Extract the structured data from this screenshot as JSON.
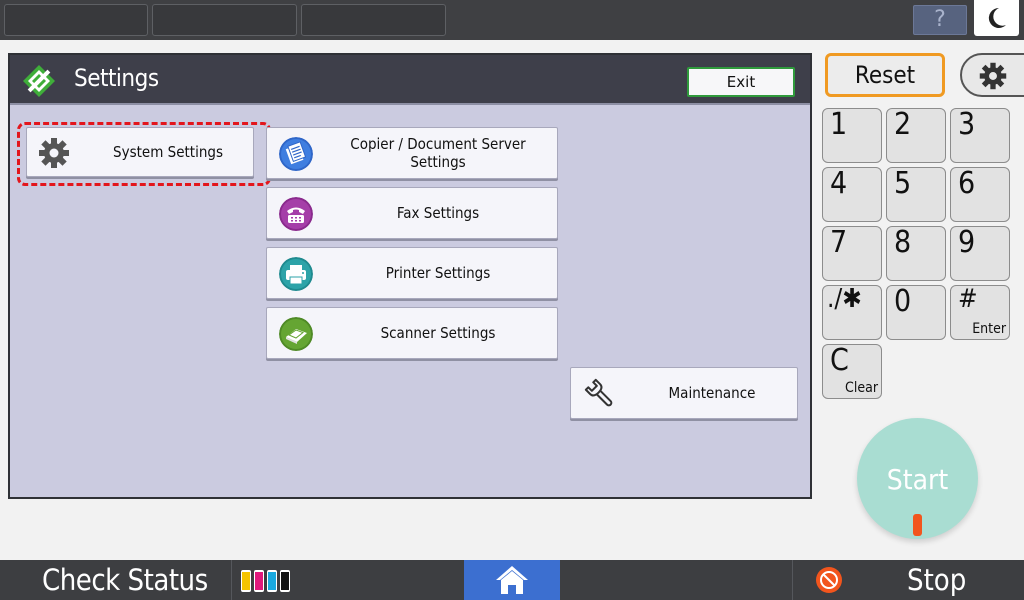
{
  "header": {
    "help_label": "?"
  },
  "panel": {
    "title": "Settings",
    "exit_label": "Exit"
  },
  "menu": {
    "system_settings": "System Settings",
    "copier_settings": "Copier / Document Server Settings",
    "fax_settings": "Fax Settings",
    "printer_settings": "Printer Settings",
    "scanner_settings": "Scanner Settings",
    "maintenance": "Maintenance"
  },
  "keypad": {
    "reset_label": "Reset",
    "keys": [
      {
        "label": "1"
      },
      {
        "label": "2"
      },
      {
        "label": "3"
      },
      {
        "label": "4"
      },
      {
        "label": "5"
      },
      {
        "label": "6"
      },
      {
        "label": "7"
      },
      {
        "label": "8"
      },
      {
        "label": "9"
      },
      {
        "label": ".∕✱"
      },
      {
        "label": "0"
      },
      {
        "label": "#",
        "sub": "Enter"
      },
      {
        "label": "C",
        "sub": "Clear"
      }
    ],
    "start_label": "Start"
  },
  "footer": {
    "check_status": "Check Status",
    "stop_label": "Stop"
  },
  "colors": {
    "accent_green": "#2f9a3c",
    "reset_border": "#f09a22",
    "focus_ring": "#e3161c",
    "home_blue": "#3c6fd0",
    "start_teal": "#a9ddd2",
    "stop_orange": "#f2551d"
  },
  "icons": {
    "logo": "settings-logo-icon",
    "system": "gear-icon",
    "copier": "copier-document-icon",
    "fax": "fax-icon",
    "printer": "printer-icon",
    "scanner": "scanner-icon",
    "maintenance": "wrench-icon",
    "home": "home-icon",
    "stop": "stop-icon",
    "moon": "moon-icon",
    "toner": "toner-levels-icon"
  }
}
